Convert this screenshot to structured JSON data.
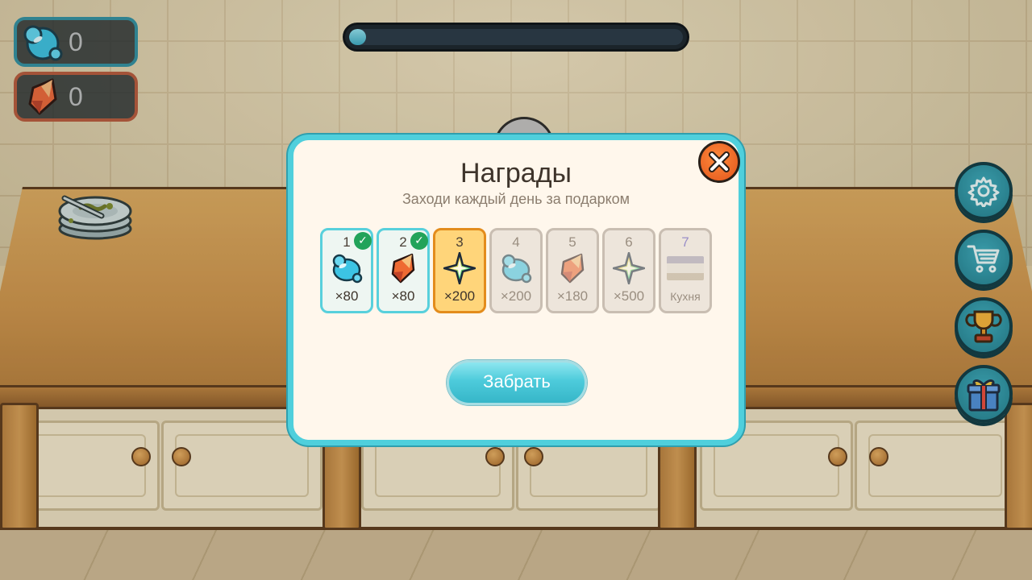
{
  "hud": {
    "soap_count": "0",
    "shard_count": "0",
    "progress_fraction": 0.05
  },
  "side_menu": {
    "items": [
      {
        "icon": "gear-icon"
      },
      {
        "icon": "cart-icon"
      },
      {
        "icon": "trophy-icon"
      },
      {
        "icon": "gift-icon"
      }
    ]
  },
  "dialog": {
    "title": "Награды",
    "subtitle": "Заходи каждый день за подарком",
    "claim_label": "Забрать",
    "days": [
      {
        "day": "1",
        "reward_icon": "soap-bubble-icon",
        "amount": "×80",
        "state": "claimed"
      },
      {
        "day": "2",
        "reward_icon": "crystal-shard-icon",
        "amount": "×80",
        "state": "claimed"
      },
      {
        "day": "3",
        "reward_icon": "sparkle-star-icon",
        "amount": "×200",
        "state": "current"
      },
      {
        "day": "4",
        "reward_icon": "soap-bubble-icon",
        "amount": "×200",
        "state": "future"
      },
      {
        "day": "5",
        "reward_icon": "crystal-shard-icon",
        "amount": "×180",
        "state": "future"
      },
      {
        "day": "6",
        "reward_icon": "sparkle-star-icon",
        "amount": "×500",
        "state": "future"
      },
      {
        "day": "7",
        "reward_icon": "kitchen-thumbnail",
        "amount": "Кухня",
        "state": "special"
      }
    ]
  },
  "colors": {
    "dialog_border": "#4fcfdc",
    "current_day_fill": "#ffd57a",
    "current_day_border": "#e38c1c",
    "claimed_check": "#22a35a",
    "close_button": "#e2541a"
  }
}
